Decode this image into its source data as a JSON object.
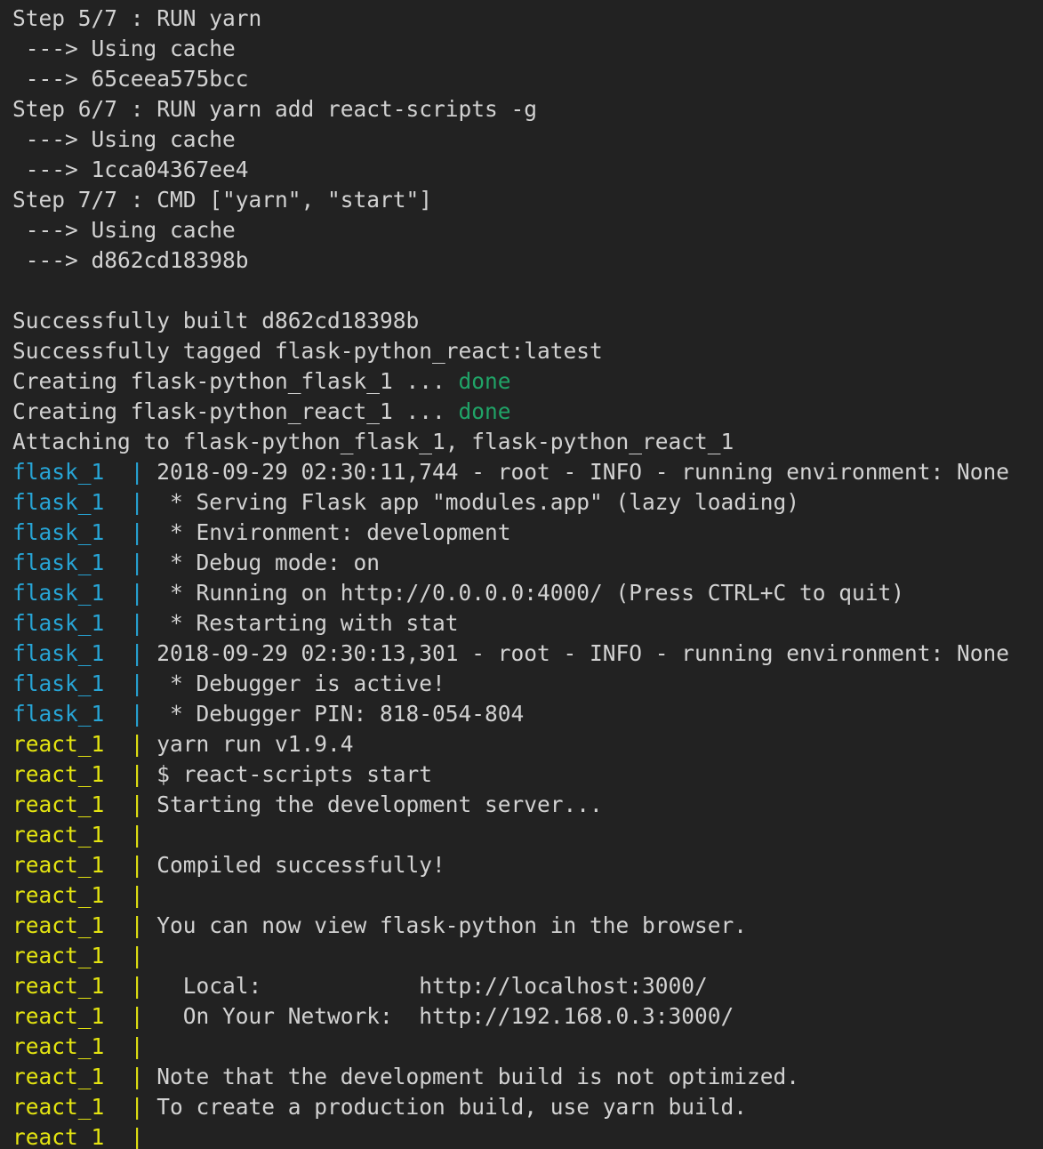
{
  "terminal": {
    "background_color": "#222222",
    "default_text_color": "#d2d2d2",
    "colors": {
      "green": "#20a367",
      "cyan": "#27a5d6",
      "yellow": "#e4e411"
    },
    "service_prefixes": {
      "flask": "flask_1",
      "react": "react_1"
    },
    "lines": [
      {
        "id": "l01",
        "segments": [
          {
            "text": "Step 5/7 : RUN yarn",
            "color": "default"
          }
        ]
      },
      {
        "id": "l02",
        "segments": [
          {
            "text": " ---> Using cache",
            "color": "default"
          }
        ]
      },
      {
        "id": "l03",
        "segments": [
          {
            "text": " ---> 65ceea575bcc",
            "color": "default"
          }
        ]
      },
      {
        "id": "l04",
        "segments": [
          {
            "text": "Step 6/7 : RUN yarn add react-scripts -g",
            "color": "default"
          }
        ]
      },
      {
        "id": "l05",
        "segments": [
          {
            "text": " ---> Using cache",
            "color": "default"
          }
        ]
      },
      {
        "id": "l06",
        "segments": [
          {
            "text": " ---> 1cca04367ee4",
            "color": "default"
          }
        ]
      },
      {
        "id": "l07",
        "segments": [
          {
            "text": "Step 7/7 : CMD [\"yarn\", \"start\"]",
            "color": "default"
          }
        ]
      },
      {
        "id": "l08",
        "segments": [
          {
            "text": " ---> Using cache",
            "color": "default"
          }
        ]
      },
      {
        "id": "l09",
        "segments": [
          {
            "text": " ---> d862cd18398b",
            "color": "default"
          }
        ]
      },
      {
        "id": "l10",
        "segments": [
          {
            "text": "",
            "color": "default"
          }
        ]
      },
      {
        "id": "l11",
        "segments": [
          {
            "text": "Successfully built d862cd18398b",
            "color": "default"
          }
        ]
      },
      {
        "id": "l12",
        "segments": [
          {
            "text": "Successfully tagged flask-python_react:latest",
            "color": "default"
          }
        ]
      },
      {
        "id": "l13",
        "segments": [
          {
            "text": "Creating flask-python_flask_1 ... ",
            "color": "default"
          },
          {
            "text": "done",
            "color": "green"
          }
        ]
      },
      {
        "id": "l14",
        "segments": [
          {
            "text": "Creating flask-python_react_1 ... ",
            "color": "default"
          },
          {
            "text": "done",
            "color": "green"
          }
        ]
      },
      {
        "id": "l15",
        "segments": [
          {
            "text": "Attaching to flask-python_flask_1, flask-python_react_1",
            "color": "default"
          }
        ]
      },
      {
        "id": "l16",
        "segments": [
          {
            "text": "flask_1  ",
            "color": "cyan"
          },
          {
            "text": "| ",
            "color": "cyan"
          },
          {
            "text": "2018-09-29 02:30:11,744 - root - INFO - running environment: None",
            "color": "default"
          }
        ]
      },
      {
        "id": "l17",
        "segments": [
          {
            "text": "flask_1  ",
            "color": "cyan"
          },
          {
            "text": "| ",
            "color": "cyan"
          },
          {
            "text": " * Serving Flask app \"modules.app\" (lazy loading)",
            "color": "default"
          }
        ]
      },
      {
        "id": "l18",
        "segments": [
          {
            "text": "flask_1  ",
            "color": "cyan"
          },
          {
            "text": "| ",
            "color": "cyan"
          },
          {
            "text": " * Environment: development",
            "color": "default"
          }
        ]
      },
      {
        "id": "l19",
        "segments": [
          {
            "text": "flask_1  ",
            "color": "cyan"
          },
          {
            "text": "| ",
            "color": "cyan"
          },
          {
            "text": " * Debug mode: on",
            "color": "default"
          }
        ]
      },
      {
        "id": "l20",
        "segments": [
          {
            "text": "flask_1  ",
            "color": "cyan"
          },
          {
            "text": "| ",
            "color": "cyan"
          },
          {
            "text": " * Running on http://0.0.0.0:4000/ (Press CTRL+C to quit)",
            "color": "default"
          }
        ]
      },
      {
        "id": "l21",
        "segments": [
          {
            "text": "flask_1  ",
            "color": "cyan"
          },
          {
            "text": "| ",
            "color": "cyan"
          },
          {
            "text": " * Restarting with stat",
            "color": "default"
          }
        ]
      },
      {
        "id": "l22",
        "segments": [
          {
            "text": "flask_1  ",
            "color": "cyan"
          },
          {
            "text": "| ",
            "color": "cyan"
          },
          {
            "text": "2018-09-29 02:30:13,301 - root - INFO - running environment: None",
            "color": "default"
          }
        ]
      },
      {
        "id": "l23",
        "segments": [
          {
            "text": "flask_1  ",
            "color": "cyan"
          },
          {
            "text": "| ",
            "color": "cyan"
          },
          {
            "text": " * Debugger is active!",
            "color": "default"
          }
        ]
      },
      {
        "id": "l24",
        "segments": [
          {
            "text": "flask_1  ",
            "color": "cyan"
          },
          {
            "text": "| ",
            "color": "cyan"
          },
          {
            "text": " * Debugger PIN: 818-054-804",
            "color": "default"
          }
        ]
      },
      {
        "id": "l25",
        "segments": [
          {
            "text": "react_1  ",
            "color": "yellow"
          },
          {
            "text": "| ",
            "color": "yellow"
          },
          {
            "text": "yarn run v1.9.4",
            "color": "default"
          }
        ]
      },
      {
        "id": "l26",
        "segments": [
          {
            "text": "react_1  ",
            "color": "yellow"
          },
          {
            "text": "| ",
            "color": "yellow"
          },
          {
            "text": "$ react-scripts start",
            "color": "default"
          }
        ]
      },
      {
        "id": "l27",
        "segments": [
          {
            "text": "react_1  ",
            "color": "yellow"
          },
          {
            "text": "| ",
            "color": "yellow"
          },
          {
            "text": "Starting the development server...",
            "color": "default"
          }
        ]
      },
      {
        "id": "l28",
        "segments": [
          {
            "text": "react_1  ",
            "color": "yellow"
          },
          {
            "text": "| ",
            "color": "yellow"
          },
          {
            "text": "",
            "color": "default"
          }
        ]
      },
      {
        "id": "l29",
        "segments": [
          {
            "text": "react_1  ",
            "color": "yellow"
          },
          {
            "text": "| ",
            "color": "yellow"
          },
          {
            "text": "Compiled successfully!",
            "color": "default"
          }
        ]
      },
      {
        "id": "l30",
        "segments": [
          {
            "text": "react_1  ",
            "color": "yellow"
          },
          {
            "text": "| ",
            "color": "yellow"
          },
          {
            "text": "",
            "color": "default"
          }
        ]
      },
      {
        "id": "l31",
        "segments": [
          {
            "text": "react_1  ",
            "color": "yellow"
          },
          {
            "text": "| ",
            "color": "yellow"
          },
          {
            "text": "You can now view flask-python in the browser.",
            "color": "default"
          }
        ]
      },
      {
        "id": "l32",
        "segments": [
          {
            "text": "react_1  ",
            "color": "yellow"
          },
          {
            "text": "| ",
            "color": "yellow"
          },
          {
            "text": "",
            "color": "default"
          }
        ]
      },
      {
        "id": "l33",
        "segments": [
          {
            "text": "react_1  ",
            "color": "yellow"
          },
          {
            "text": "| ",
            "color": "yellow"
          },
          {
            "text": "  Local:            http://localhost:3000/",
            "color": "default"
          }
        ]
      },
      {
        "id": "l34",
        "segments": [
          {
            "text": "react_1  ",
            "color": "yellow"
          },
          {
            "text": "| ",
            "color": "yellow"
          },
          {
            "text": "  On Your Network:  http://192.168.0.3:3000/",
            "color": "default"
          }
        ]
      },
      {
        "id": "l35",
        "segments": [
          {
            "text": "react_1  ",
            "color": "yellow"
          },
          {
            "text": "| ",
            "color": "yellow"
          },
          {
            "text": "",
            "color": "default"
          }
        ]
      },
      {
        "id": "l36",
        "segments": [
          {
            "text": "react_1  ",
            "color": "yellow"
          },
          {
            "text": "| ",
            "color": "yellow"
          },
          {
            "text": "Note that the development build is not optimized.",
            "color": "default"
          }
        ]
      },
      {
        "id": "l37",
        "segments": [
          {
            "text": "react_1  ",
            "color": "yellow"
          },
          {
            "text": "| ",
            "color": "yellow"
          },
          {
            "text": "To create a production build, use yarn build.",
            "color": "default"
          }
        ]
      },
      {
        "id": "l38",
        "segments": [
          {
            "text": "react_1  ",
            "color": "yellow"
          },
          {
            "text": "| ",
            "color": "yellow"
          },
          {
            "text": "",
            "color": "default"
          }
        ]
      }
    ]
  }
}
